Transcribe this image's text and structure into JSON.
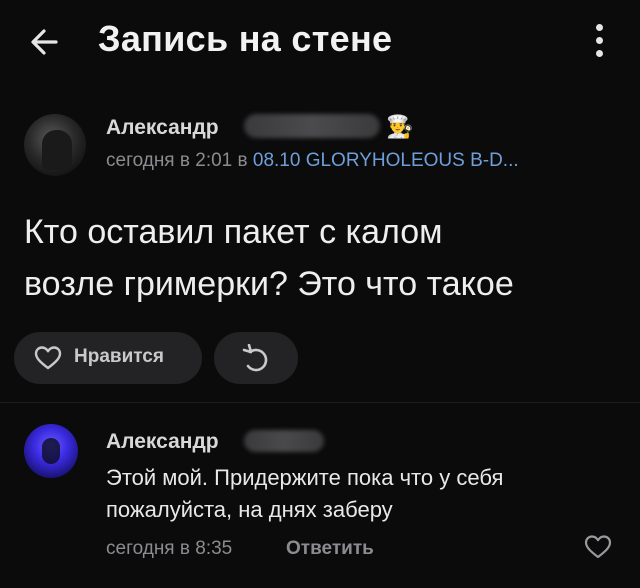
{
  "header": {
    "title": "Запись на стене",
    "back_icon": "back-arrow-icon",
    "more_icon": "more-vertical-icon"
  },
  "post": {
    "author": "Александр",
    "author_emoji": "👨‍🍳",
    "time": "сегодня в 2:01 в ",
    "group": "08.10 GLORYHOLEOUS B-D...",
    "text_lines": [
      "Кто оставил пакет с калом",
      "возле гримерки? Это что такое"
    ],
    "like_label": "Нравится"
  },
  "comment": {
    "author": "Александр",
    "text_lines": [
      "Этой мой. Придержите пока что у себя",
      "пожалуйста, на днях заберу"
    ],
    "time": "сегодня в 8:35",
    "reply_label": "Ответить"
  },
  "colors": {
    "background": "#0b0b0c",
    "link": "#6f9fd8",
    "muted": "#8c8c90",
    "button_bg": "#232325"
  }
}
